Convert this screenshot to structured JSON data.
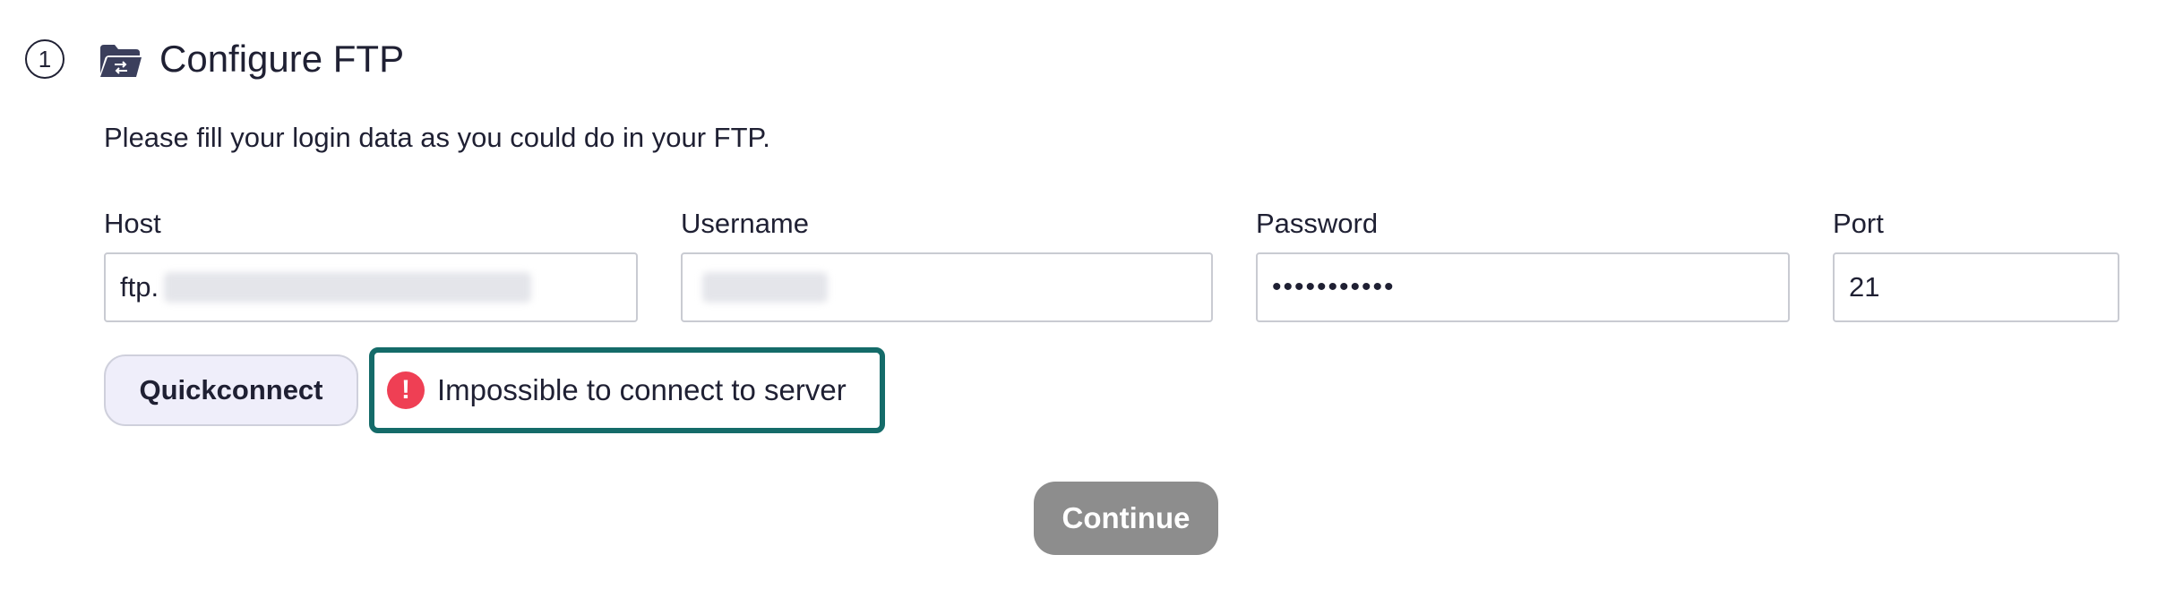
{
  "step": {
    "number": "1",
    "icon": "folder-sync-icon",
    "title": "Configure FTP"
  },
  "subtitle": "Please fill your login data as you could do in your FTP.",
  "fields": {
    "host": {
      "label": "Host",
      "value_prefix": "ftp."
    },
    "username": {
      "label": "Username",
      "value": ""
    },
    "password": {
      "label": "Password",
      "value": "•••••••••••"
    },
    "port": {
      "label": "Port",
      "value": "21"
    }
  },
  "actions": {
    "quickconnect_label": "Quickconnect",
    "continue_label": "Continue"
  },
  "error": {
    "icon": "exclamation-circle-icon",
    "message": "Impossible to connect to server"
  },
  "colors": {
    "error_border": "#146b69",
    "error_icon": "#ef3f54",
    "quickconnect_bg": "#efeefa",
    "continue_bg": "#8d8d8d"
  }
}
